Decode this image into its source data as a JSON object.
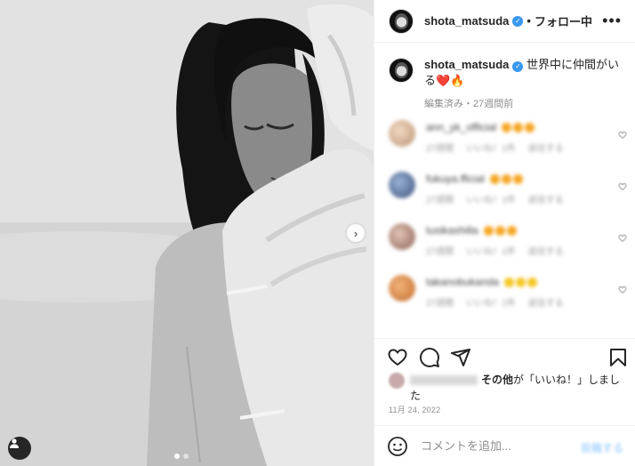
{
  "header": {
    "username": "shota_matsuda",
    "separator": "•",
    "follow_label": "フォロー中",
    "more_label": "•••"
  },
  "caption": {
    "username": "shota_matsuda",
    "text": "世界中に仲間がいる❤️🔥",
    "meta": "編集済み・27週間前"
  },
  "comments": [
    {
      "name": "ann_yk_official",
      "emoji_color": "#f5a623",
      "line2": [
        "27週間",
        "いいね！1件",
        "返信する"
      ],
      "avatar": "radial-gradient(circle at 40% 40%, #f3d9c3, #b79373)"
    },
    {
      "name": "fukuya.fficial",
      "emoji_color": "#f5a623",
      "line2": [
        "27週間",
        "いいね！1件",
        "返信する"
      ],
      "avatar": "radial-gradient(circle at 40% 40%, #9bb3d6, #3a4f7a)"
    },
    {
      "name": "tusikashilla",
      "emoji_color": "#f5a623",
      "line2": [
        "27週間",
        "いいね！1件",
        "返信する"
      ],
      "avatar": "radial-gradient(circle at 40% 40%, #e3c5b6, #8a5f52)"
    },
    {
      "name": "takanobukanda",
      "emoji_color": "#f5c623",
      "line2": [
        "27週間",
        "いいね！1件",
        "返信する"
      ],
      "avatar": "radial-gradient(circle at 40% 40%, #f2b37a, #c26c2d)"
    }
  ],
  "likes": {
    "others_label": "その他",
    "suffix_text": "が「いいね！」しました"
  },
  "date": "11月 24, 2022",
  "composer": {
    "placeholder": "コメントを追加...",
    "post_label": "投稿する"
  },
  "colors": {
    "verified": "#3897f0",
    "border": "#efefef",
    "muted": "#8e8e8e"
  },
  "icons": [
    "next-arrow-icon",
    "user-tag-icon",
    "heart-icon",
    "comment-icon",
    "share-icon",
    "bookmark-icon",
    "emoji-icon",
    "more-icon",
    "verified-icon"
  ]
}
